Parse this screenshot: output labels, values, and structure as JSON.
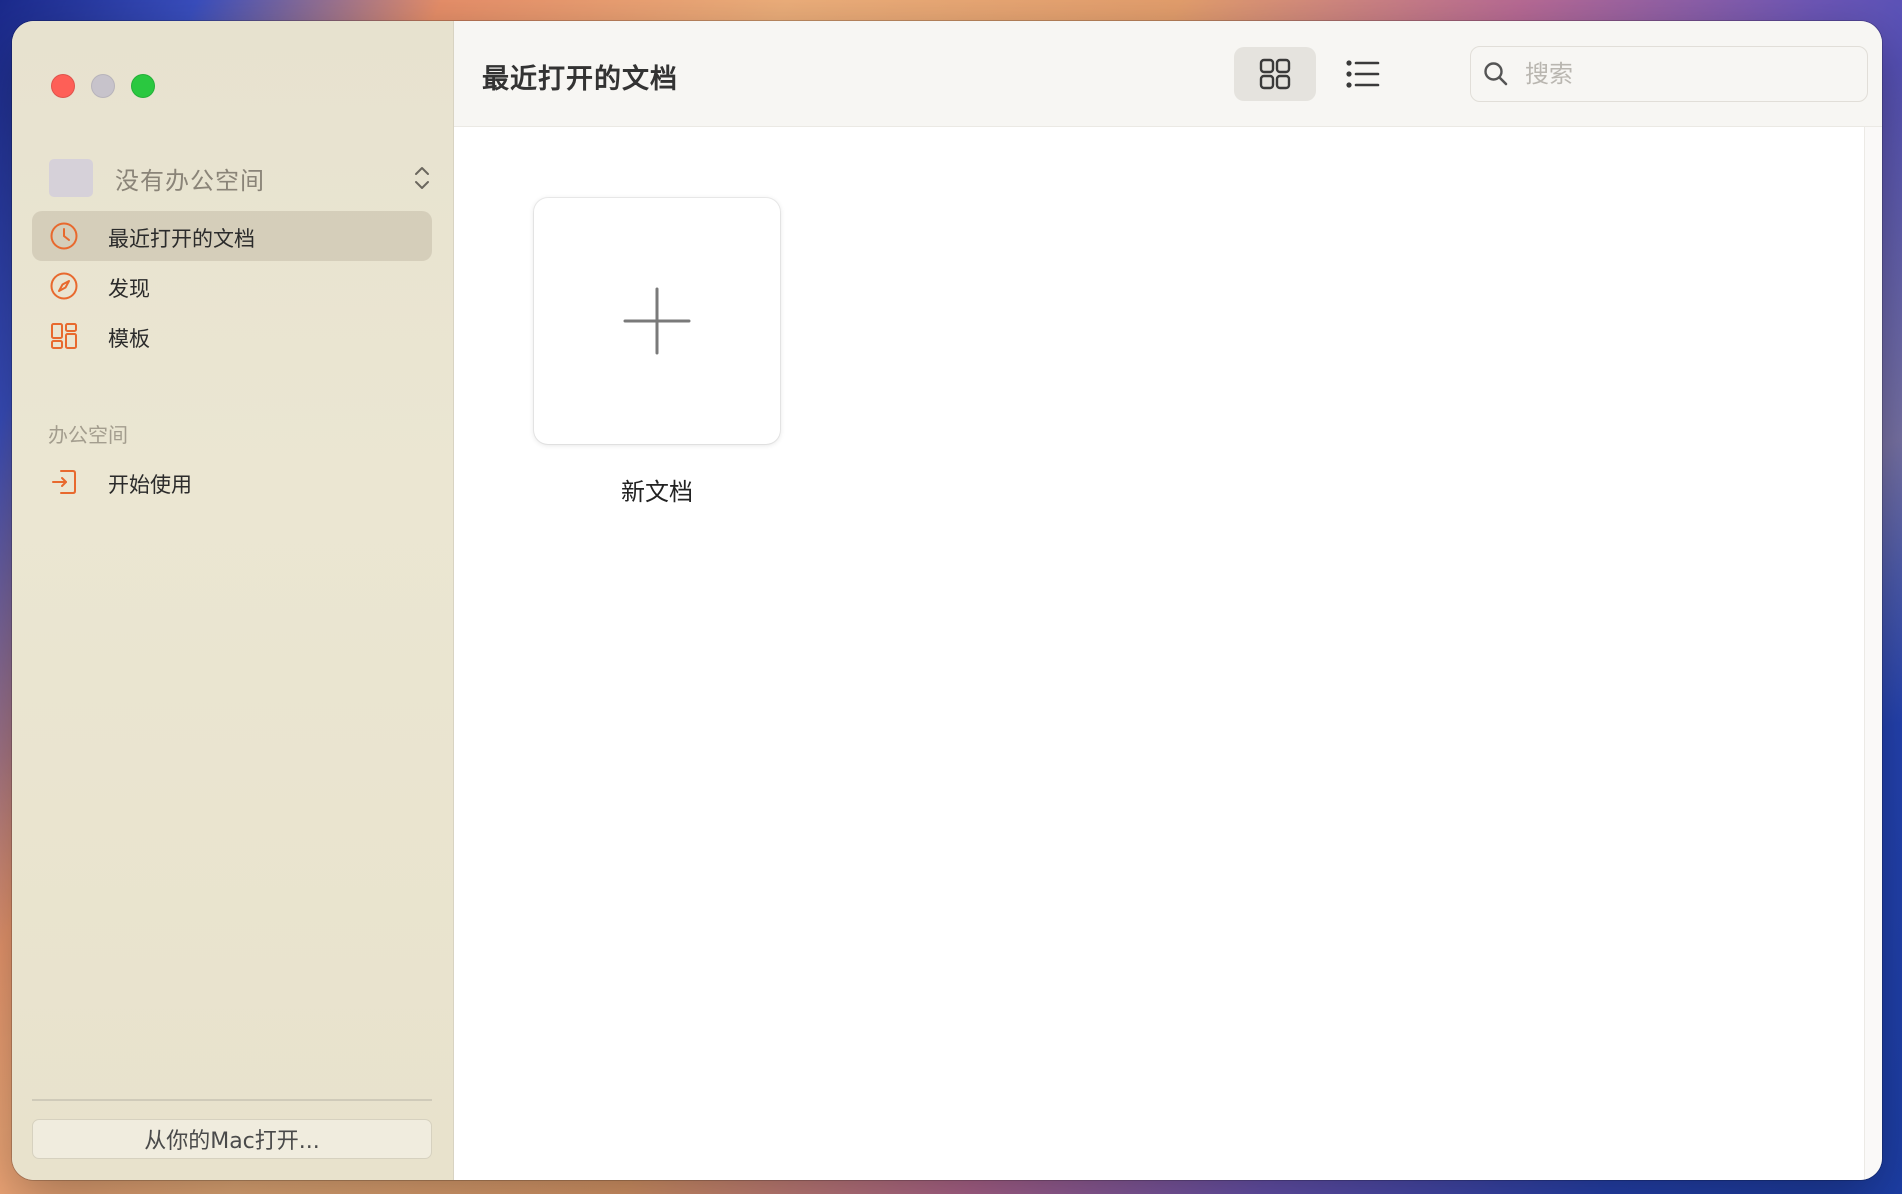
{
  "window": {
    "traffic_lights": [
      "close",
      "minimize",
      "zoom"
    ]
  },
  "sidebar": {
    "workspace_label": "没有办公空间",
    "items": [
      {
        "label": "最近打开的文档",
        "icon": "clock-icon",
        "active": true
      },
      {
        "label": "发现",
        "icon": "compass-icon",
        "active": false
      },
      {
        "label": "模板",
        "icon": "template-grid-icon",
        "active": false
      }
    ],
    "section_title": "办公空间",
    "section_items": [
      {
        "label": "开始使用",
        "icon": "sign-in-icon"
      }
    ],
    "open_mac_label": "从你的Mac打开..."
  },
  "toolbar": {
    "title": "最近打开的文档",
    "view_mode": "grid",
    "search_placeholder": "搜索"
  },
  "content": {
    "new_doc_label": "新文档"
  },
  "colors": {
    "accent": "#e8692e",
    "sidebar_bg": "#e9e4d0",
    "active_item_bg": "#d8d1bd"
  }
}
